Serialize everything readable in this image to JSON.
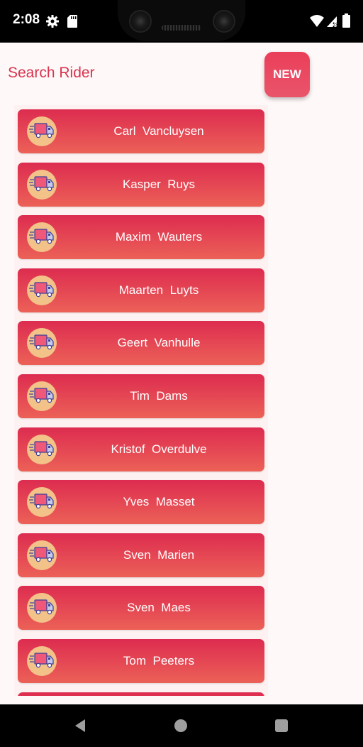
{
  "status_bar": {
    "time": "2:08",
    "icons": [
      "gear-icon",
      "sd-card-icon",
      "wifi-icon",
      "signal-icon",
      "battery-icon"
    ]
  },
  "header": {
    "title": "Search Rider",
    "new_button_label": "NEW"
  },
  "riders": [
    {
      "name": "Carl  Vancluysen",
      "icon": "delivery-truck-icon"
    },
    {
      "name": "Kasper  Ruys",
      "icon": "delivery-truck-icon"
    },
    {
      "name": "Maxim  Wauters",
      "icon": "delivery-truck-icon"
    },
    {
      "name": "Maarten  Luyts",
      "icon": "delivery-truck-icon"
    },
    {
      "name": "Geert  Vanhulle",
      "icon": "delivery-truck-icon"
    },
    {
      "name": "Tim  Dams",
      "icon": "delivery-truck-icon"
    },
    {
      "name": "Kristof  Overdulve",
      "icon": "delivery-truck-icon"
    },
    {
      "name": "Yves  Masset",
      "icon": "delivery-truck-icon"
    },
    {
      "name": "Sven  Marien",
      "icon": "delivery-truck-icon"
    },
    {
      "name": "Sven  Maes",
      "icon": "delivery-truck-icon"
    },
    {
      "name": "Tom  Peeters",
      "icon": "delivery-truck-icon"
    },
    {
      "name": "",
      "icon": "delivery-truck-icon"
    }
  ],
  "colors": {
    "accent": "#d8344f",
    "item_gradient_top": "#dd2c50",
    "item_gradient_bottom": "#ec6157",
    "avatar_bg": "#f2c288",
    "page_bg": "#fff8f8"
  },
  "nav_bar": {
    "icons": [
      "back-icon",
      "home-icon",
      "recent-apps-icon"
    ]
  }
}
